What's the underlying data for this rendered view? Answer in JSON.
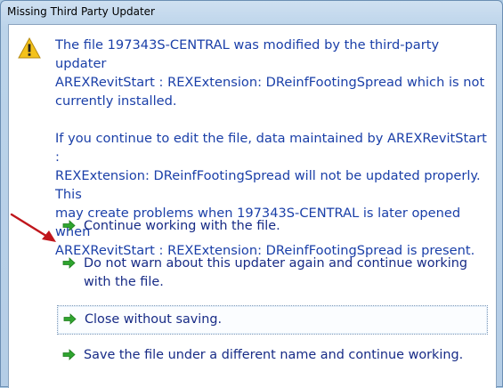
{
  "window": {
    "title": "Missing Third Party Updater"
  },
  "message": {
    "paragraph1": "The file 197343S-CENTRAL was modified by the third-party updater\nAREXRevitStart : REXExtension: DReinfFootingSpread which is not\ncurrently installed.",
    "paragraph2": "If you continue to edit the file, data maintained by AREXRevitStart :\nREXExtension: DReinfFootingSpread will not be updated properly. This\nmay create problems when 197343S-CENTRAL  is later opened when\nAREXRevitStart : REXExtension: DReinfFootingSpread is present."
  },
  "commands": [
    {
      "label": "Continue working with the file."
    },
    {
      "label": "Do not warn about this updater again and continue working with the file."
    },
    {
      "label": "Close without saving."
    },
    {
      "label": "Save the file under a different name and continue working."
    }
  ],
  "icons": {
    "warning": "warning-icon",
    "command_arrow": "green-arrow-icon",
    "annotation": "red-arrow-annotation"
  },
  "colors": {
    "message_text": "#1a3fa8",
    "command_text": "#172b86",
    "command_arrow": "#2fa52f",
    "annotation_arrow": "#c0161c"
  }
}
